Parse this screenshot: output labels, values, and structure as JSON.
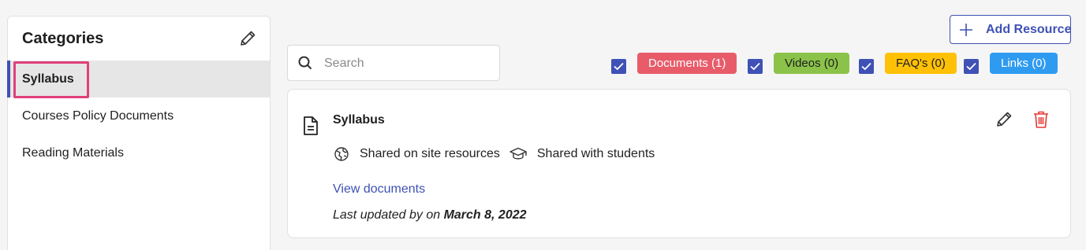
{
  "sidebar": {
    "title": "Categories",
    "items": [
      {
        "label": "Syllabus"
      },
      {
        "label": "Courses Policy Documents"
      },
      {
        "label": "Reading Materials"
      }
    ]
  },
  "search": {
    "placeholder": "Search",
    "value": ""
  },
  "toolbar": {
    "add_label": "Add Resource"
  },
  "filters": [
    {
      "label": "Documents (1)",
      "checked": true,
      "color": "#e85c6a"
    },
    {
      "label": "Videos (0)",
      "checked": true,
      "color": "#8bc34a"
    },
    {
      "label": "FAQ's (0)",
      "checked": true,
      "color": "#ffc107"
    },
    {
      "label": "Links (0)",
      "checked": true,
      "color": "#2f9bf0"
    }
  ],
  "resource": {
    "title": "Syllabus",
    "shared_site": "Shared on site resources",
    "shared_students": "Shared with students",
    "view_link": "View documents",
    "updated_prefix": "Last updated by on ",
    "updated_date": "March 8, 2022"
  },
  "colors": {
    "accent": "#3f51b5",
    "highlight": "#e0407a",
    "delete": "#e53935"
  }
}
